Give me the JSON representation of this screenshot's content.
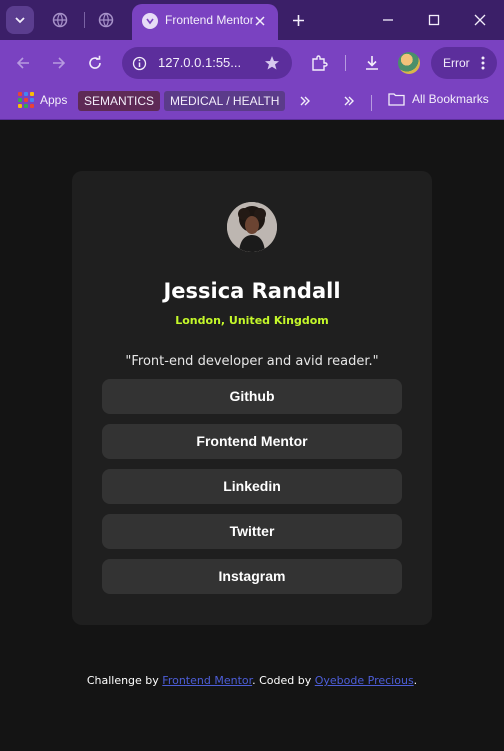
{
  "browser": {
    "active_tab_title": "Frontend Mentor",
    "url": "127.0.0.1:55...",
    "profile_status": "Error",
    "bookmarks": {
      "apps_label": "Apps",
      "items": [
        "SEMANTICS",
        "MEDICAL / HEALTH"
      ],
      "all_label": "All Bookmarks"
    }
  },
  "profile": {
    "name": "Jessica Randall",
    "location": "London, United Kingdom",
    "bio": "\"Front-end developer and avid reader.\"",
    "links": [
      "Github",
      "Frontend Mentor",
      "Linkedin",
      "Twitter",
      "Instagram"
    ]
  },
  "footer": {
    "prefix": "Challenge by ",
    "link1": "Frontend Mentor",
    "middle": ". Coded by ",
    "link2": "Oyebode Precious",
    "suffix": "."
  },
  "colors": {
    "page_bg": "#141414",
    "card_bg": "#1f1f1f",
    "button_bg": "#333333",
    "accent_location": "#c4f82a",
    "chrome_purple": "#7a42c1",
    "chrome_dark": "#3b1f68"
  }
}
